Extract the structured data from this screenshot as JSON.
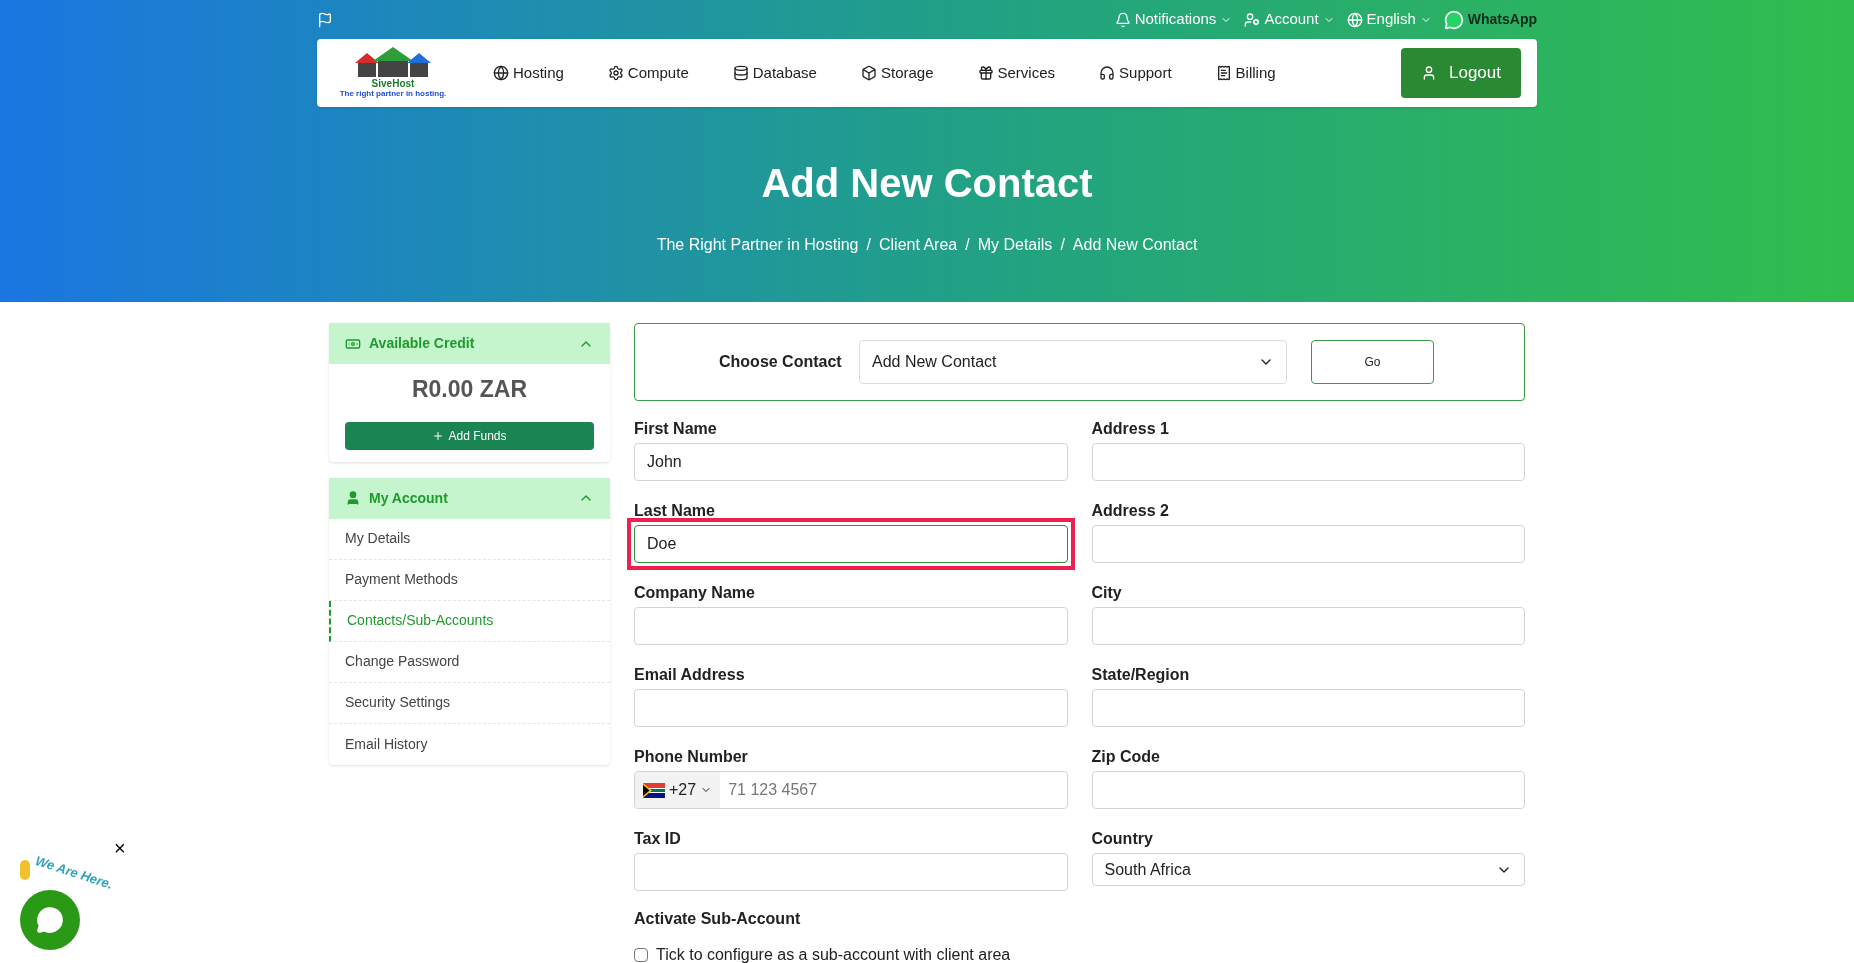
{
  "topbar": {
    "items": [
      {
        "label": "Notifications",
        "kind": "bell"
      },
      {
        "label": "Account",
        "kind": "user"
      },
      {
        "label": "English",
        "kind": "globe"
      }
    ],
    "whatsapp": "WhatsApp"
  },
  "logo": {
    "name": "SiveHost",
    "tagline": "The right partner in hosting."
  },
  "nav": [
    {
      "label": "Hosting",
      "kind": "globe"
    },
    {
      "label": "Compute",
      "kind": "gear"
    },
    {
      "label": "Database",
      "kind": "database"
    },
    {
      "label": "Storage",
      "kind": "box"
    },
    {
      "label": "Services",
      "kind": "gift"
    },
    {
      "label": "Support",
      "kind": "headset"
    },
    {
      "label": "Billing",
      "kind": "receipt"
    }
  ],
  "logout": "Logout",
  "hero": {
    "title": "Add New Contact",
    "breadcrumb": [
      "The Right Partner in Hosting",
      "Client Area",
      "My Details",
      "Add New Contact"
    ],
    "separator": "/"
  },
  "credit": {
    "title": "Available Credit",
    "expanded": true,
    "amount": "R0.00 ZAR",
    "button": "Add Funds"
  },
  "account": {
    "title": "My Account",
    "expanded": true,
    "items": [
      {
        "label": "My Details",
        "selected": false
      },
      {
        "label": "Payment Methods",
        "selected": false
      },
      {
        "label": "Contacts/Sub-Accounts",
        "selected": true
      },
      {
        "label": "Change Password",
        "selected": false
      },
      {
        "label": "Security Settings",
        "selected": false
      },
      {
        "label": "Email History",
        "selected": false
      }
    ]
  },
  "chooser": {
    "label": "Choose Contact",
    "value": "Add New Contact",
    "button": "Go"
  },
  "fields": [
    {
      "label": "First Name",
      "kind": "text",
      "value": "John",
      "highlighted": false
    },
    {
      "label": "Address 1",
      "kind": "text",
      "highlighted": false
    },
    {
      "label": "Last Name",
      "kind": "text",
      "value": "Doe",
      "highlighted": true
    },
    {
      "label": "Address 2",
      "kind": "text",
      "highlighted": false
    },
    {
      "label": "Company Name",
      "kind": "text",
      "highlighted": false
    },
    {
      "label": "City",
      "kind": "text",
      "highlighted": false
    },
    {
      "label": "Email Address",
      "kind": "text",
      "highlighted": false
    },
    {
      "label": "State/Region",
      "kind": "text",
      "highlighted": false
    },
    {
      "label": "Phone Number",
      "kind": "phone",
      "dial_code": "+27",
      "placeholder": "71 123 4567",
      "highlighted": false
    },
    {
      "label": "Zip Code",
      "kind": "text",
      "highlighted": false
    },
    {
      "label": "Tax ID",
      "kind": "text",
      "highlighted": false
    },
    {
      "label": "Country",
      "kind": "select",
      "value": "South Africa",
      "highlighted": false
    }
  ],
  "subaccount": {
    "title": "Activate Sub-Account",
    "checkbox_label": "Tick to configure as a sub-account with client area",
    "checked": false
  },
  "chat_widget": {
    "caption": "We Are Here.",
    "close": "×"
  }
}
